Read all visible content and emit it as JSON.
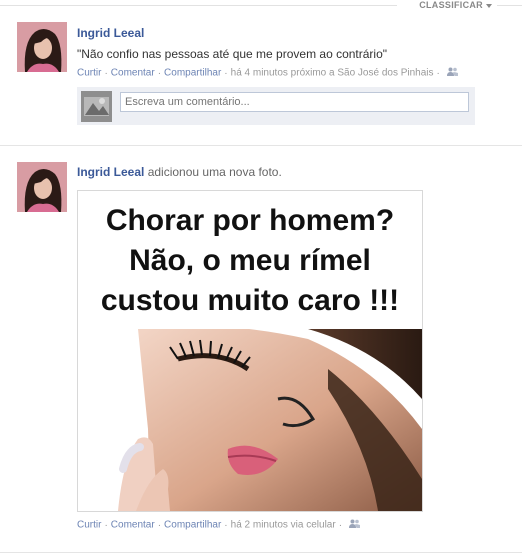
{
  "feed": {
    "sort_label": "CLASSIFICAR",
    "comment_placeholder": "Escreva um comentário...",
    "actions": {
      "like": "Curtir",
      "comment": "Comentar",
      "share": "Compartilhar"
    },
    "stories": [
      {
        "author": "Ingrid Leeal",
        "message": "\"Não confio nas pessoas até que me provem ao contrário\"",
        "time": "há 4 minutos próximo a São José dos Pinhais",
        "audience_icon": "friends-icon"
      },
      {
        "author": "Ingrid Leeal",
        "action_text": "adicionou uma nova foto.",
        "photo_caption_lines": [
          "Chorar por homem?",
          "Não, o meu rímel",
          "custou muito caro !!!"
        ],
        "time": "há 2 minutos via celular",
        "audience_icon": "friends-icon"
      }
    ]
  },
  "colors": {
    "link": "#3b5998",
    "meta_link": "#6d84b4",
    "comment_bg": "#edeff4"
  }
}
